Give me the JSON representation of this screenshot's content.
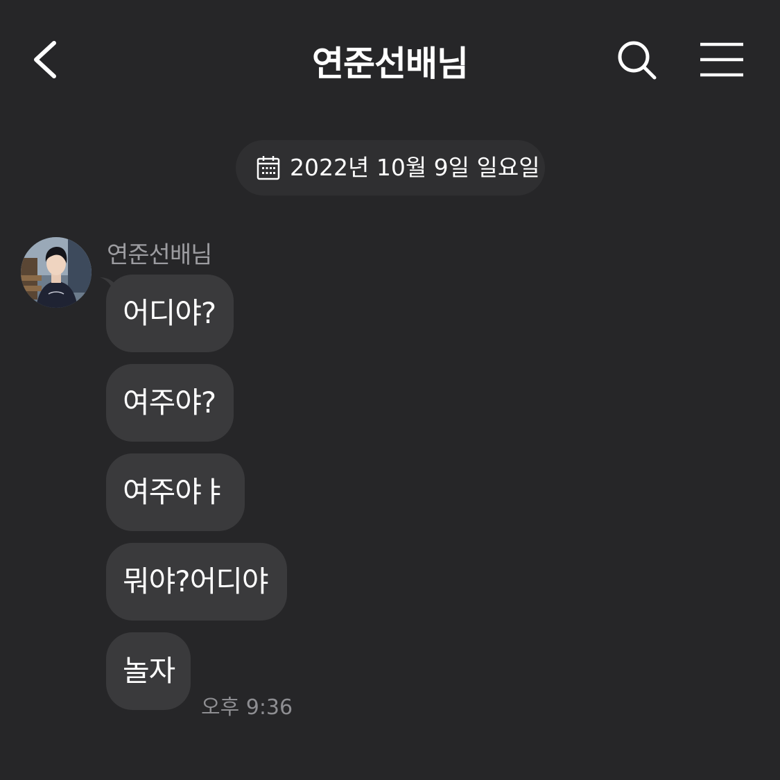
{
  "header": {
    "title": "연준선배님",
    "back_icon": "chevron-left-icon",
    "search_icon": "search-icon",
    "menu_icon": "hamburger-menu-icon"
  },
  "date_divider": {
    "icon": "calendar-icon",
    "text": "2022년 10월 9일 일요일"
  },
  "thread": {
    "sender_name": "연준선배님",
    "avatar_icon": "profile-photo",
    "messages": [
      {
        "text": "어디야?"
      },
      {
        "text": "여주야?"
      },
      {
        "text": "여주야ㅑ"
      },
      {
        "text": "뭐야?어디야"
      },
      {
        "text": "놀자"
      }
    ],
    "timestamp": "오후 9:36"
  },
  "colors": {
    "background": "#262628",
    "bubble": "#3a3a3c",
    "pill": "#2f2f31",
    "secondary_text": "#9c9ca0"
  }
}
